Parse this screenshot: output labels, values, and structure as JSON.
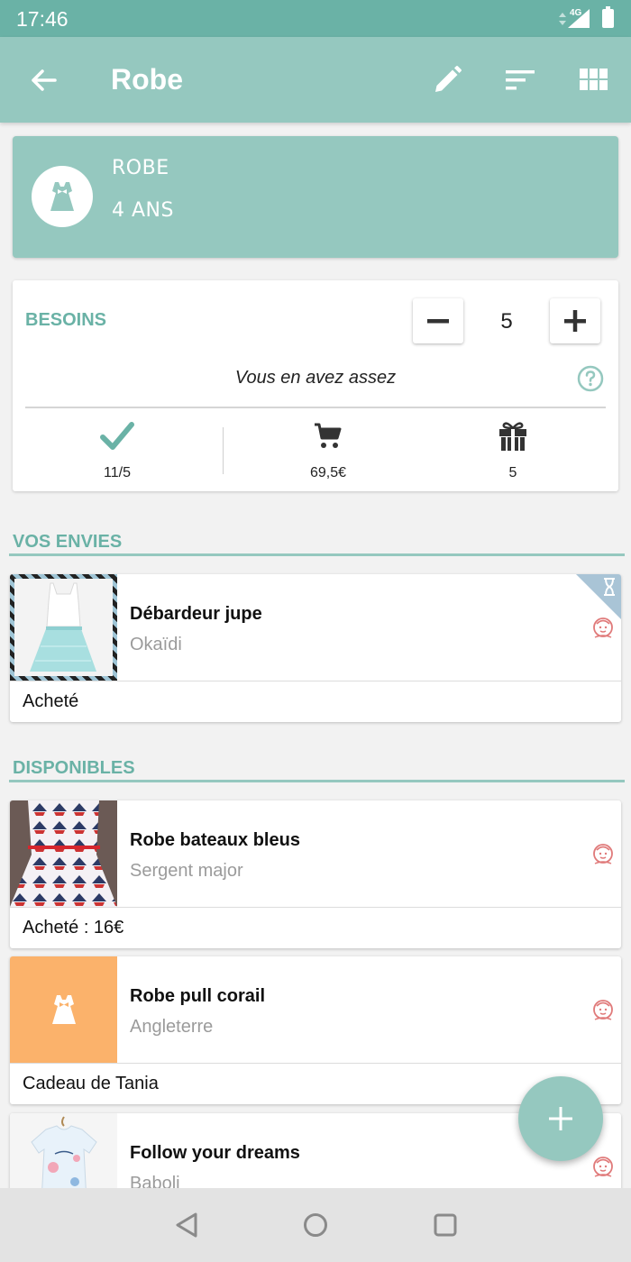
{
  "status_bar": {
    "time": "17:46",
    "network": "4G"
  },
  "app_bar": {
    "title": "Robe",
    "icons": [
      "arrow-back-icon",
      "pencil-icon",
      "sort-icon",
      "grid-icon"
    ]
  },
  "category": {
    "icon": "dress-icon",
    "name": "ROBE",
    "age": "4 ANS"
  },
  "needs": {
    "label": "BESOINS",
    "count": "5",
    "message": "Vous en avez assez",
    "stats": {
      "owned": {
        "icon": "check-icon",
        "value": "11/5"
      },
      "spent": {
        "icon": "cart-icon",
        "value": "69,5€"
      },
      "gifts": {
        "icon": "gift-icon",
        "value": "5"
      }
    }
  },
  "wishes": {
    "title": "VOS ENVIES",
    "items": [
      {
        "name": "Débardeur jupe",
        "brand": "Okaïdi",
        "status": "Acheté",
        "badge": "hourglass-icon"
      }
    ]
  },
  "available": {
    "title": "DISPONIBLES",
    "items": [
      {
        "name": "Robe bateaux bleus",
        "brand": "Sergent major",
        "status": "Acheté : 16€"
      },
      {
        "name": "Robe pull corail",
        "brand": "Angleterre",
        "status": "Cadeau de Tania"
      },
      {
        "name": "Follow your dreams",
        "brand": "Baboli",
        "status": ""
      }
    ]
  },
  "colors": {
    "primary": "#95c8bf",
    "primary_dark": "#6ab2a6",
    "accent_orange": "#fbb26b",
    "kid_icon": "#e07a7a"
  }
}
